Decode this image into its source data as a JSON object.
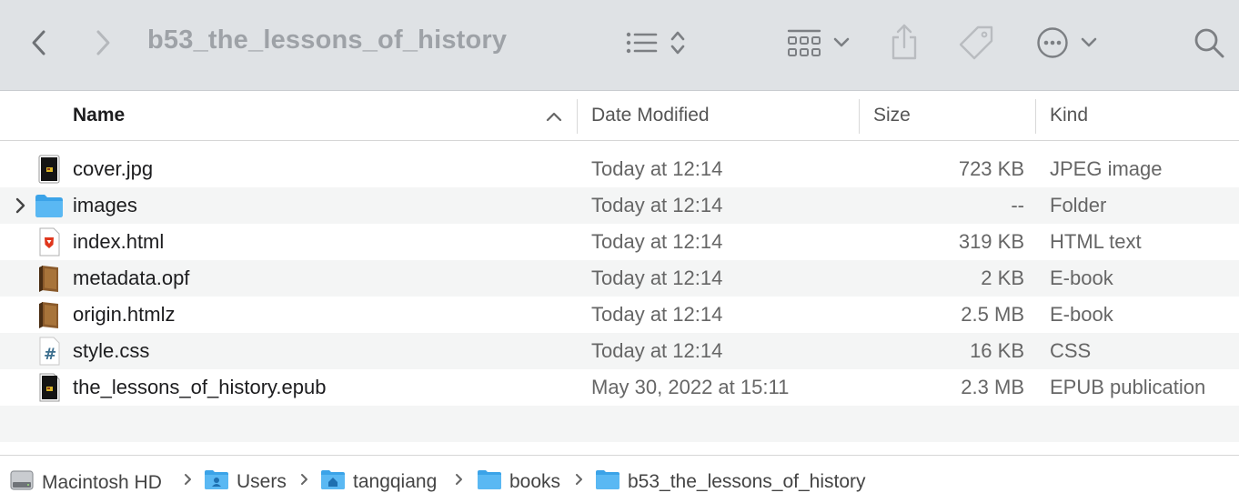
{
  "window": {
    "title": "b53_the_lessons_of_history"
  },
  "toolbar": {
    "icons": [
      "back-icon",
      "forward-icon",
      "list-view-icon",
      "sort-updown-icon",
      "group-icon",
      "chevron-down-icon",
      "share-icon",
      "tag-icon",
      "more-icon",
      "search-icon"
    ]
  },
  "columns": {
    "name": "Name",
    "date": "Date Modified",
    "size": "Size",
    "kind": "Kind"
  },
  "files": [
    {
      "name": "cover.jpg",
      "date": "Today at 12:14",
      "size": "723 KB",
      "kind": "JPEG image",
      "icon": "jpeg-file-icon"
    },
    {
      "name": "images",
      "date": "Today at 12:14",
      "size": "--",
      "kind": "Folder",
      "icon": "folder-icon"
    },
    {
      "name": "index.html",
      "date": "Today at 12:14",
      "size": "319 KB",
      "kind": "HTML text",
      "icon": "html-file-icon"
    },
    {
      "name": "metadata.opf",
      "date": "Today at 12:14",
      "size": "2 KB",
      "kind": "E-book",
      "icon": "ebook-icon"
    },
    {
      "name": "origin.htmlz",
      "date": "Today at 12:14",
      "size": "2.5 MB",
      "kind": "E-book",
      "icon": "ebook-icon"
    },
    {
      "name": "style.css",
      "date": "Today at 12:14",
      "size": "16 KB",
      "kind": "CSS",
      "icon": "css-file-icon"
    },
    {
      "name": "the_lessons_of_history.epub",
      "date": "May 30, 2022 at 15:11",
      "size": "2.3 MB",
      "kind": "EPUB publication",
      "icon": "epub-file-icon"
    }
  ],
  "pathbar": {
    "items": [
      "Macintosh HD",
      "Users",
      "tangqiang",
      "books",
      "b53_the_lessons_of_history"
    ]
  },
  "colors": {
    "toolbar_bg": "#dfe2e5",
    "folder_blue": "#3ba3e8",
    "row_alt": "#f4f5f5"
  }
}
